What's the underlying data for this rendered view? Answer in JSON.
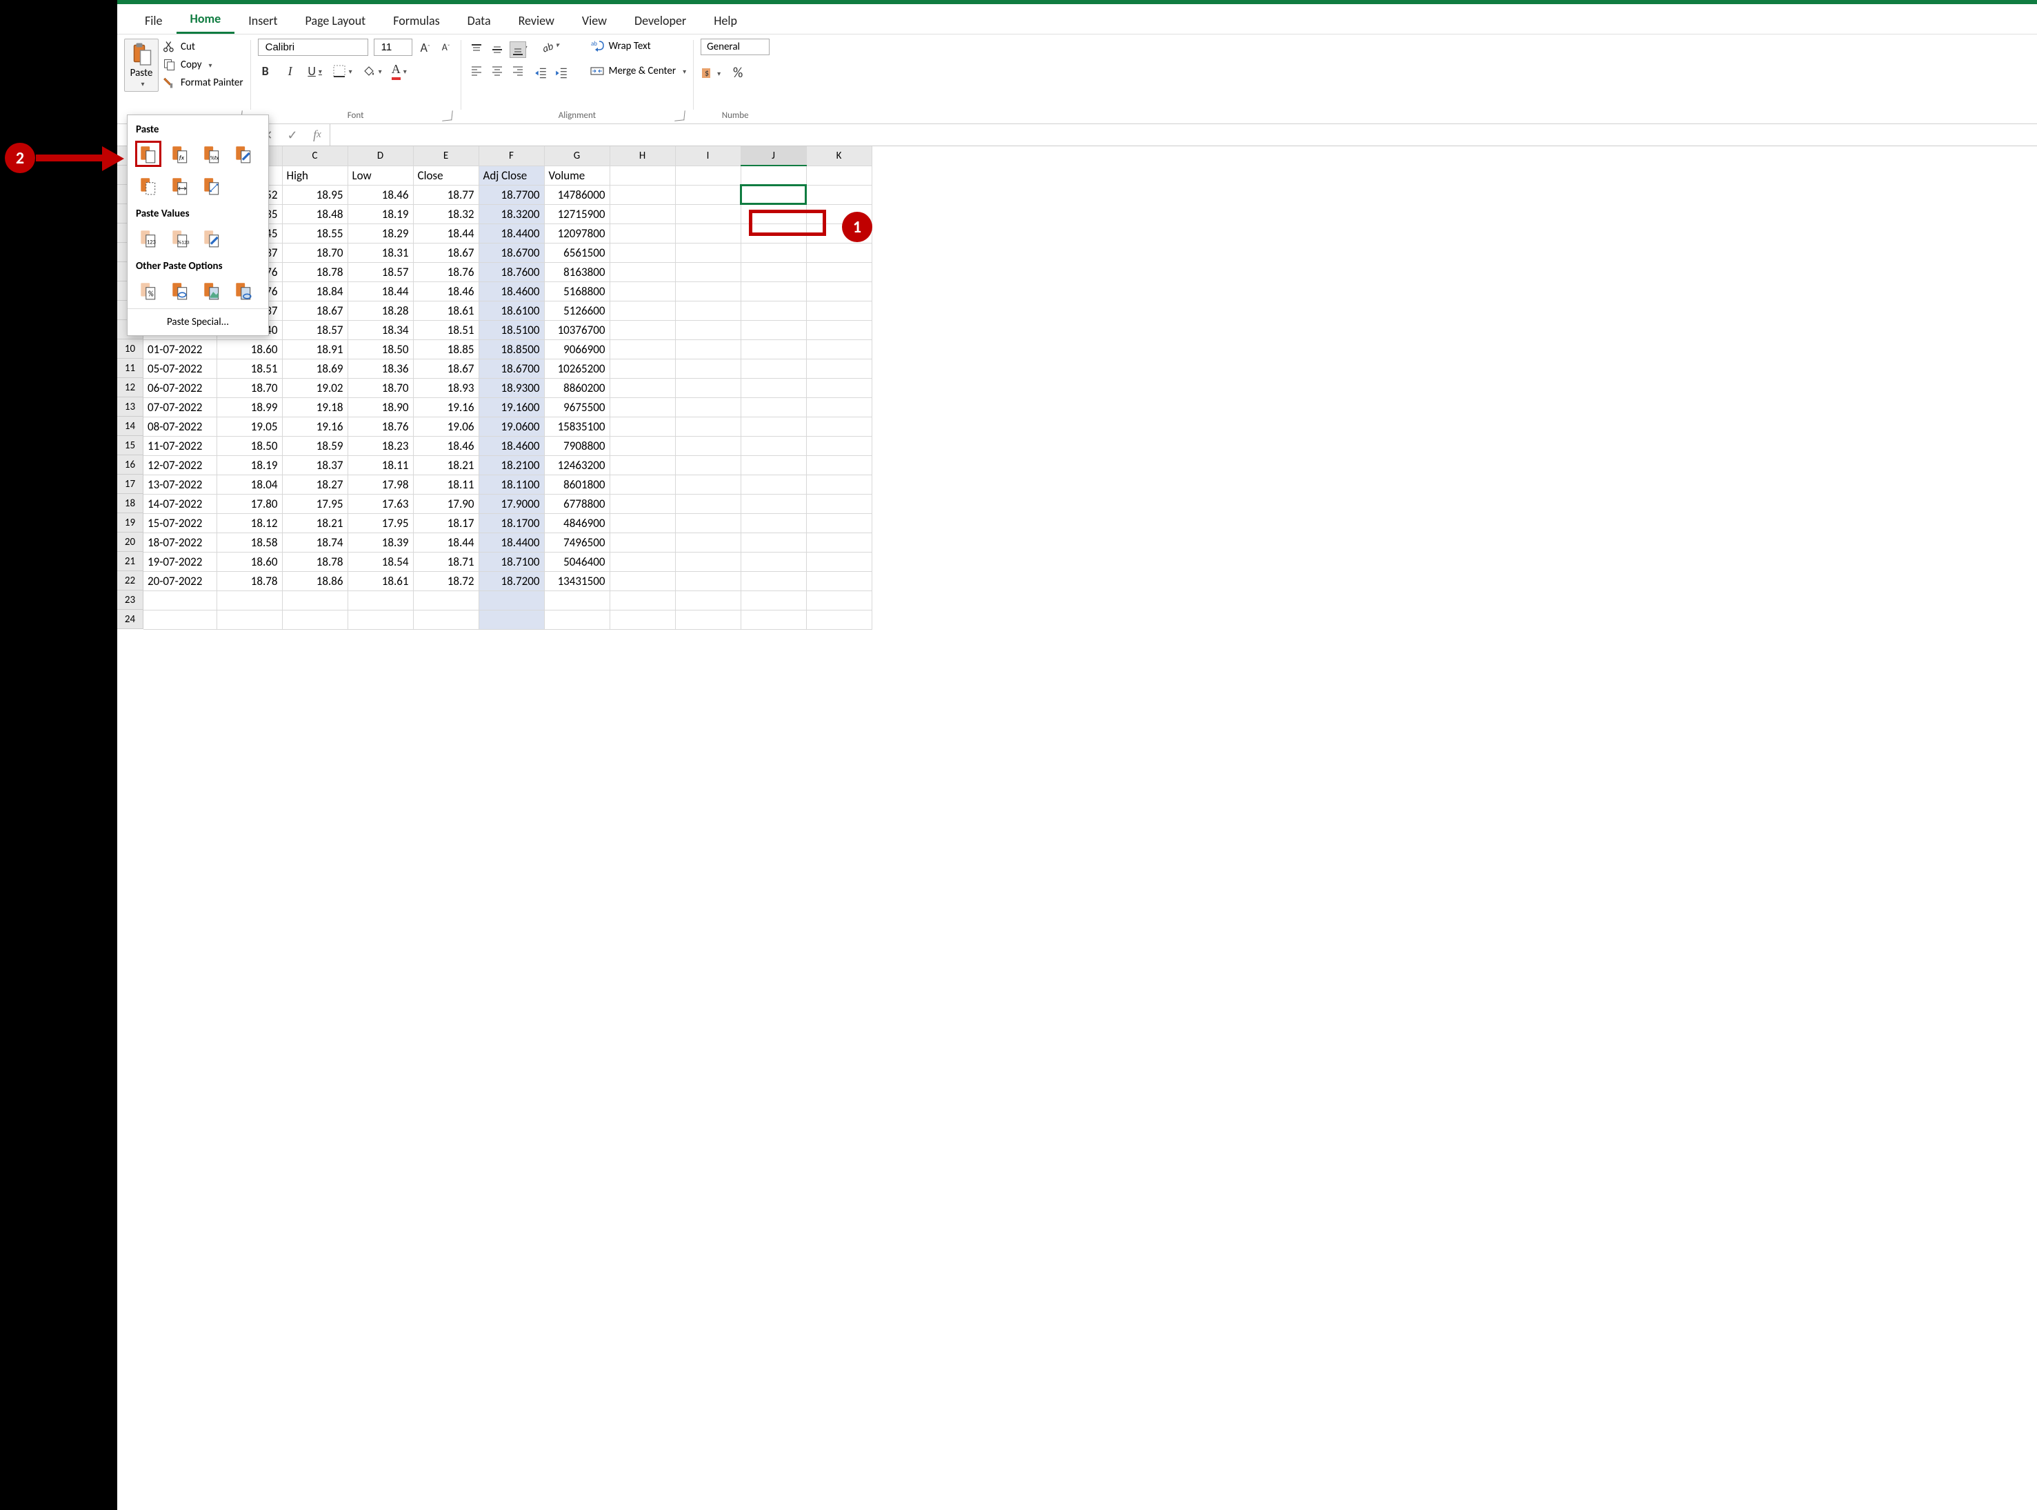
{
  "tabs": {
    "file": "File",
    "home": "Home",
    "insert": "Insert",
    "page_layout": "Page Layout",
    "formulas": "Formulas",
    "data": "Data",
    "review": "Review",
    "view": "View",
    "developer": "Developer",
    "help": "Help"
  },
  "ribbon": {
    "paste": "Paste",
    "cut": "Cut",
    "copy": "Copy",
    "format_painter": "Format Painter",
    "font_name": "Calibri",
    "font_size": "11",
    "font_group": "Font",
    "alignment_group": "Alignment",
    "number_group": "Numbe",
    "wrap_text": "Wrap Text",
    "merge_center": "Merge & Center",
    "number_format": "General"
  },
  "paste_dropdown": {
    "paste": "Paste",
    "paste_values": "Paste Values",
    "other_paste": "Other Paste Options",
    "paste_special": "Paste Special..."
  },
  "sheet": {
    "columns": [
      "C",
      "D",
      "E",
      "F",
      "G",
      "H",
      "I",
      "J",
      "K"
    ],
    "headers": {
      "c": "High",
      "d": "Low",
      "e": "Close",
      "f": "Adj Close",
      "g": "Volume"
    },
    "rows": [
      {
        "rh": "",
        "partB": "52",
        "c": "18.95",
        "d": "18.46",
        "e": "18.77",
        "f": "18.7700",
        "g": "14786000"
      },
      {
        "rh": "",
        "partB": "35",
        "c": "18.48",
        "d": "18.19",
        "e": "18.32",
        "f": "18.3200",
        "g": "12715900"
      },
      {
        "rh": "",
        "partB": "45",
        "c": "18.55",
        "d": "18.29",
        "e": "18.44",
        "f": "18.4400",
        "g": "12097800"
      },
      {
        "rh": "",
        "partB": "37",
        "c": "18.70",
        "d": "18.31",
        "e": "18.67",
        "f": "18.6700",
        "g": "6561500"
      },
      {
        "rh": "",
        "partB": "76",
        "c": "18.78",
        "d": "18.57",
        "e": "18.76",
        "f": "18.7600",
        "g": "8163800"
      },
      {
        "rh": "",
        "partB": "76",
        "c": "18.84",
        "d": "18.44",
        "e": "18.46",
        "f": "18.4600",
        "g": "5168800"
      },
      {
        "rh": "",
        "partB": "37",
        "c": "18.67",
        "d": "18.28",
        "e": "18.61",
        "f": "18.6100",
        "g": "5126600"
      },
      {
        "rh": "",
        "partB": "40",
        "c": "18.57",
        "d": "18.34",
        "e": "18.51",
        "f": "18.5100",
        "g": "10376700"
      },
      {
        "rh": "10",
        "a": "01-07-2022",
        "b": "18.60",
        "c": "18.91",
        "d": "18.50",
        "e": "18.85",
        "f": "18.8500",
        "g": "9066900"
      },
      {
        "rh": "11",
        "a": "05-07-2022",
        "b": "18.51",
        "c": "18.69",
        "d": "18.36",
        "e": "18.67",
        "f": "18.6700",
        "g": "10265200"
      },
      {
        "rh": "12",
        "a": "06-07-2022",
        "b": "18.70",
        "c": "19.02",
        "d": "18.70",
        "e": "18.93",
        "f": "18.9300",
        "g": "8860200"
      },
      {
        "rh": "13",
        "a": "07-07-2022",
        "b": "18.99",
        "c": "19.18",
        "d": "18.90",
        "e": "19.16",
        "f": "19.1600",
        "g": "9675500"
      },
      {
        "rh": "14",
        "a": "08-07-2022",
        "b": "19.05",
        "c": "19.16",
        "d": "18.76",
        "e": "19.06",
        "f": "19.0600",
        "g": "15835100"
      },
      {
        "rh": "15",
        "a": "11-07-2022",
        "b": "18.50",
        "c": "18.59",
        "d": "18.23",
        "e": "18.46",
        "f": "18.4600",
        "g": "7908800"
      },
      {
        "rh": "16",
        "a": "12-07-2022",
        "b": "18.19",
        "c": "18.37",
        "d": "18.11",
        "e": "18.21",
        "f": "18.2100",
        "g": "12463200"
      },
      {
        "rh": "17",
        "a": "13-07-2022",
        "b": "18.04",
        "c": "18.27",
        "d": "17.98",
        "e": "18.11",
        "f": "18.1100",
        "g": "8601800"
      },
      {
        "rh": "18",
        "a": "14-07-2022",
        "b": "17.80",
        "c": "17.95",
        "d": "17.63",
        "e": "17.90",
        "f": "17.9000",
        "g": "6778800"
      },
      {
        "rh": "19",
        "a": "15-07-2022",
        "b": "18.12",
        "c": "18.21",
        "d": "17.95",
        "e": "18.17",
        "f": "18.1700",
        "g": "4846900"
      },
      {
        "rh": "20",
        "a": "18-07-2022",
        "b": "18.58",
        "c": "18.74",
        "d": "18.39",
        "e": "18.44",
        "f": "18.4400",
        "g": "7496500"
      },
      {
        "rh": "21",
        "a": "19-07-2022",
        "b": "18.60",
        "c": "18.78",
        "d": "18.54",
        "e": "18.71",
        "f": "18.7100",
        "g": "5046400"
      },
      {
        "rh": "22",
        "a": "20-07-2022",
        "b": "18.78",
        "c": "18.86",
        "d": "18.61",
        "e": "18.72",
        "f": "18.7200",
        "g": "13431500"
      },
      {
        "rh": "23"
      },
      {
        "rh": "24"
      }
    ]
  },
  "callouts": {
    "one": "1",
    "two": "2"
  }
}
